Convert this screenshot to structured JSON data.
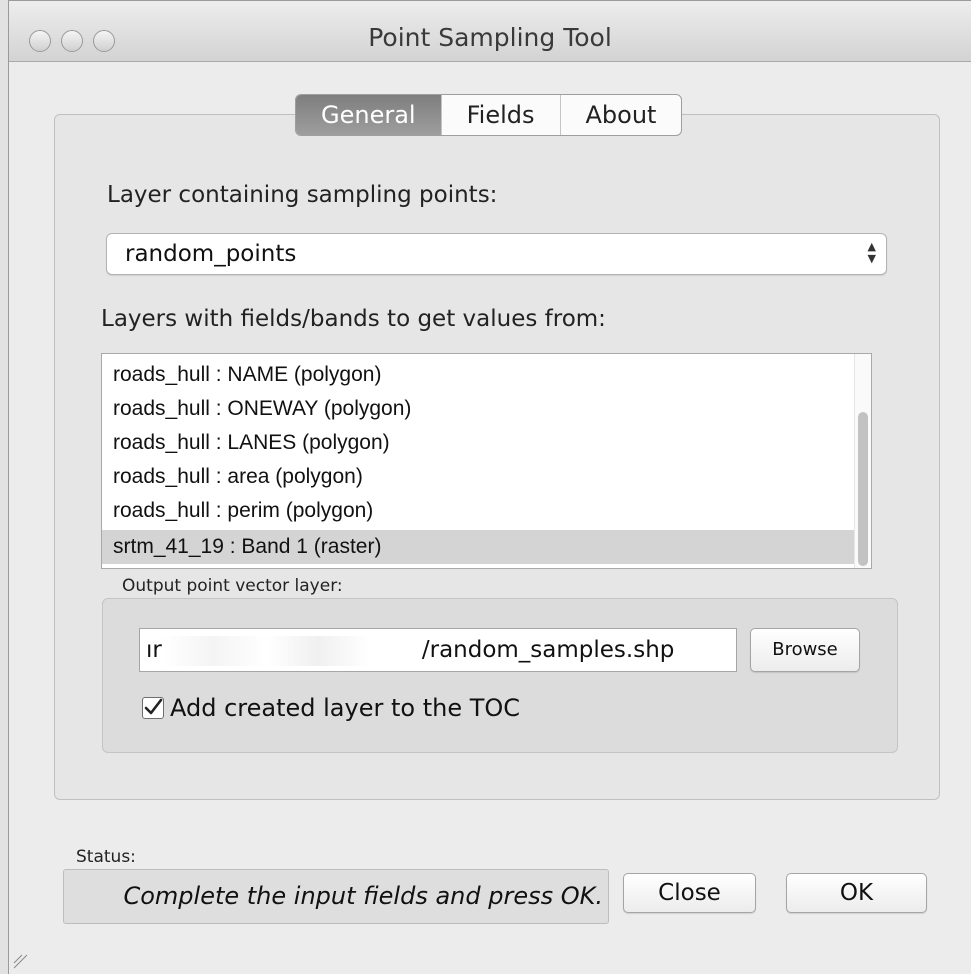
{
  "window": {
    "title": "Point Sampling Tool"
  },
  "tabs": [
    {
      "label": "General",
      "active": true
    },
    {
      "label": "Fields",
      "active": false
    },
    {
      "label": "About",
      "active": false
    }
  ],
  "general": {
    "sampling_label": "Layer containing sampling points:",
    "sampling_select": {
      "value": "random_points"
    },
    "fields_label": "Layers with fields/bands to get values from:",
    "fields_list": [
      {
        "label": "roads_hull : NAME (polygon)",
        "selected": false
      },
      {
        "label": "roads_hull : ONEWAY (polygon)",
        "selected": false
      },
      {
        "label": "roads_hull : LANES (polygon)",
        "selected": false
      },
      {
        "label": "roads_hull : area (polygon)",
        "selected": false
      },
      {
        "label": "roads_hull : perim (polygon)",
        "selected": false
      },
      {
        "label": "srtm_41_19 : Band 1 (raster)",
        "selected": true
      }
    ],
    "output": {
      "group_label": "Output point vector layer:",
      "path_prefix": "ır",
      "path_suffix": "/random_samples.shp",
      "browse_label": "Browse",
      "add_to_toc_label": "Add created layer to the TOC",
      "add_to_toc_checked": true
    }
  },
  "status": {
    "label": "Status:",
    "text": "Complete the input fields and press OK."
  },
  "buttons": {
    "close_label": "Close",
    "ok_label": "OK"
  }
}
